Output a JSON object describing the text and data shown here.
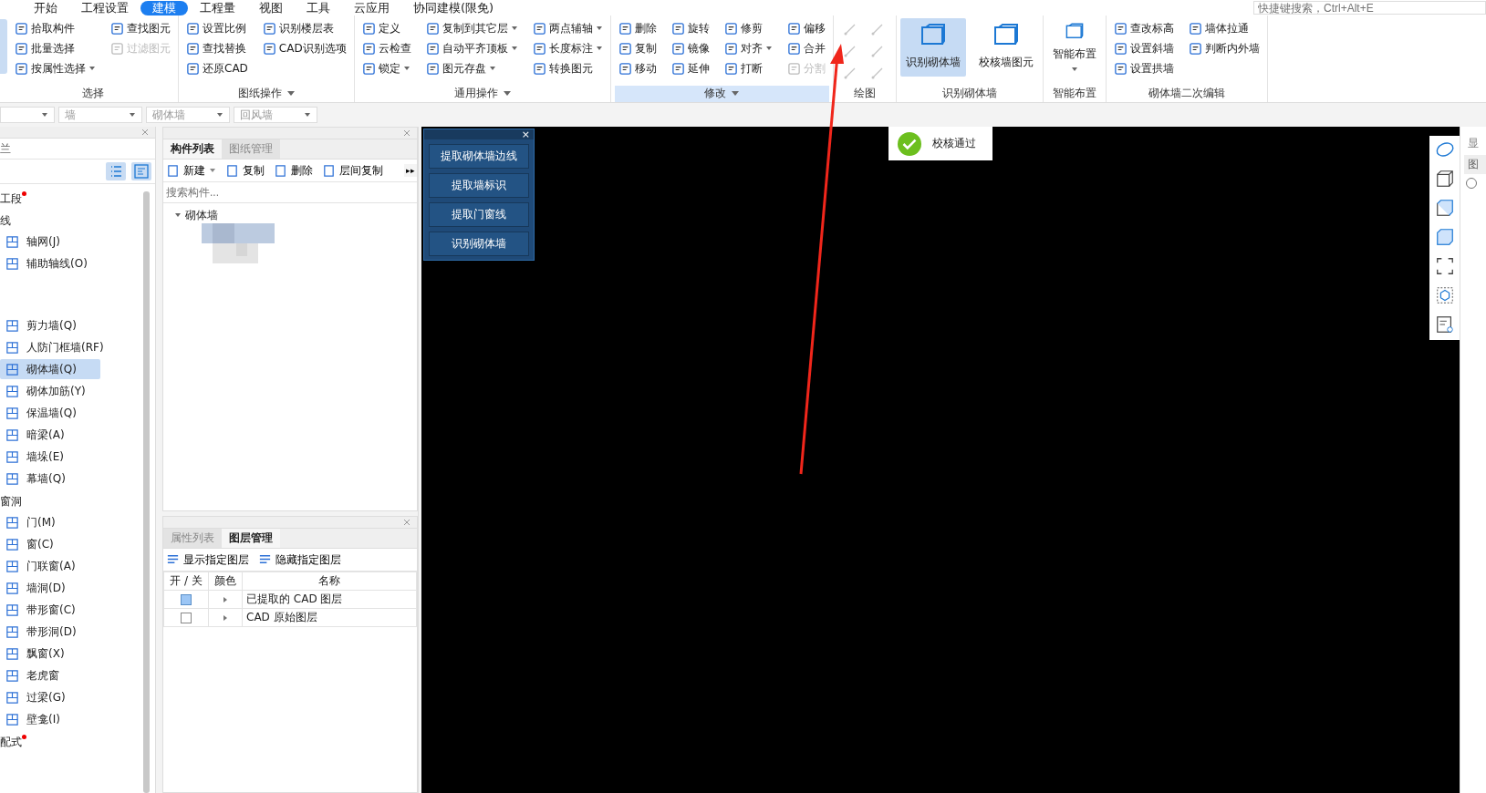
{
  "menu": {
    "tabs": [
      {
        "label": "开始",
        "selected": false
      },
      {
        "label": "工程设置",
        "selected": false
      },
      {
        "label": "建模",
        "selected": true
      },
      {
        "label": "工程量",
        "selected": false
      },
      {
        "label": "视图",
        "selected": false
      },
      {
        "label": "工具",
        "selected": false
      },
      {
        "label": "云应用",
        "selected": false
      },
      {
        "label": "协同建模(限免)",
        "selected": false
      }
    ],
    "search": {
      "placeholder": "快捷键搜索，Ctrl+Alt+E"
    }
  },
  "ribbon": {
    "groups": [
      {
        "kind": "small",
        "label": "选择",
        "dropdown": false,
        "highlighted": false,
        "columns": [
          [
            {
              "label": "拾取构件",
              "disabled": false,
              "dropdown": false
            },
            {
              "label": "批量选择",
              "disabled": false,
              "dropdown": false
            },
            {
              "label": "按属性选择",
              "disabled": false,
              "dropdown": true
            }
          ],
          [
            {
              "label": "查找图元",
              "disabled": false,
              "dropdown": false
            },
            {
              "label": "过滤图元",
              "disabled": true,
              "dropdown": false
            }
          ]
        ]
      },
      {
        "kind": "small",
        "label": "图纸操作",
        "dropdown": true,
        "highlighted": false,
        "columns": [
          [
            {
              "label": "设置比例",
              "disabled": false,
              "dropdown": false
            },
            {
              "label": "查找替换",
              "disabled": false,
              "dropdown": false
            },
            {
              "label": "还原CAD",
              "disabled": false,
              "dropdown": false
            }
          ],
          [
            {
              "label": "识别楼层表",
              "disabled": false,
              "dropdown": false
            },
            {
              "label": "CAD识别选项",
              "disabled": false,
              "dropdown": false
            }
          ]
        ]
      },
      {
        "kind": "small",
        "label": "通用操作",
        "dropdown": true,
        "highlighted": false,
        "columns": [
          [
            {
              "label": "定义",
              "disabled": false,
              "dropdown": false
            },
            {
              "label": "云检查",
              "disabled": false,
              "dropdown": false
            },
            {
              "label": "锁定",
              "disabled": false,
              "dropdown": true
            }
          ],
          [
            {
              "label": "复制到其它层",
              "disabled": false,
              "dropdown": true
            },
            {
              "label": "自动平齐顶板",
              "disabled": false,
              "dropdown": true
            },
            {
              "label": "图元存盘",
              "disabled": false,
              "dropdown": true
            }
          ],
          [
            {
              "label": "两点辅轴",
              "disabled": false,
              "dropdown": true
            },
            {
              "label": "长度标注",
              "disabled": false,
              "dropdown": true
            },
            {
              "label": "转换图元",
              "disabled": false,
              "dropdown": false
            }
          ]
        ]
      },
      {
        "kind": "small",
        "label": "修改",
        "dropdown": true,
        "highlighted": true,
        "columns": [
          [
            {
              "label": "删除",
              "disabled": false,
              "dropdown": false
            },
            {
              "label": "复制",
              "disabled": false,
              "dropdown": false
            },
            {
              "label": "移动",
              "disabled": false,
              "dropdown": false
            }
          ],
          [
            {
              "label": "旋转",
              "disabled": false,
              "dropdown": false
            },
            {
              "label": "镜像",
              "disabled": false,
              "dropdown": false
            },
            {
              "label": "延伸",
              "disabled": false,
              "dropdown": false
            }
          ],
          [
            {
              "label": "修剪",
              "disabled": false,
              "dropdown": false
            },
            {
              "label": "对齐",
              "disabled": false,
              "dropdown": true
            },
            {
              "label": "打断",
              "disabled": false,
              "dropdown": false
            }
          ],
          [
            {
              "label": "偏移",
              "disabled": false,
              "dropdown": false
            },
            {
              "label": "合并",
              "disabled": false,
              "dropdown": false
            },
            {
              "label": "分割",
              "disabled": true,
              "dropdown": false
            }
          ]
        ]
      },
      {
        "kind": "icons",
        "label": "绘图",
        "dropdown": false,
        "highlighted": false
      },
      {
        "kind": "big",
        "label": "识别砌体墙",
        "dropdown": false,
        "highlighted": false,
        "buttons": [
          {
            "label": "识别砌体墙",
            "selected": true,
            "dropdown": false
          },
          {
            "label": "校核墙图元",
            "selected": false,
            "dropdown": false
          }
        ]
      },
      {
        "kind": "big",
        "label": "智能布置",
        "dropdown": false,
        "highlighted": false,
        "buttons": [
          {
            "label": "智能布置",
            "selected": false,
            "dropdown": true
          }
        ]
      },
      {
        "kind": "small",
        "label": "砌体墙二次编辑",
        "dropdown": false,
        "highlighted": false,
        "columns": [
          [
            {
              "label": "查改标高",
              "disabled": false,
              "dropdown": false
            },
            {
              "label": "设置斜墙",
              "disabled": false,
              "dropdown": false
            },
            {
              "label": "设置拱墙",
              "disabled": false,
              "dropdown": false
            }
          ],
          [
            {
              "label": "墙体拉通",
              "disabled": false,
              "dropdown": false
            },
            {
              "label": "判断内外墙",
              "disabled": false,
              "dropdown": false
            }
          ]
        ]
      }
    ]
  },
  "selectors": [
    {
      "value": "墙"
    },
    {
      "value": "砌体墙"
    },
    {
      "value": "回风墙"
    }
  ],
  "nav_panel": {
    "title": "兰",
    "sections": [
      {
        "label": "工段",
        "dot": true
      },
      {
        "label": "线",
        "items": [
          {
            "label": "轴网(J)",
            "selected": false
          },
          {
            "label": "辅助轴线(O)",
            "selected": false
          }
        ]
      },
      {
        "items": [
          {
            "label": "剪力墙(Q)",
            "selected": false
          },
          {
            "label": "人防门框墙(RF)",
            "selected": false
          },
          {
            "label": "砌体墙(Q)",
            "selected": true
          },
          {
            "label": "砌体加筋(Y)",
            "selected": false
          },
          {
            "label": "保温墙(Q)",
            "selected": false
          },
          {
            "label": "暗梁(A)",
            "selected": false
          },
          {
            "label": "墙垛(E)",
            "selected": false
          },
          {
            "label": "幕墙(Q)",
            "selected": false
          }
        ]
      },
      {
        "label": "窗洞",
        "items": [
          {
            "label": "门(M)",
            "selected": false
          },
          {
            "label": "窗(C)",
            "selected": false
          },
          {
            "label": "门联窗(A)",
            "selected": false
          },
          {
            "label": "墙洞(D)",
            "selected": false
          },
          {
            "label": "带形窗(C)",
            "selected": false
          },
          {
            "label": "带形洞(D)",
            "selected": false
          },
          {
            "label": "飘窗(X)",
            "selected": false
          },
          {
            "label": "老虎窗",
            "selected": false
          },
          {
            "label": "过梁(G)",
            "selected": false
          },
          {
            "label": "壁龛(I)",
            "selected": false
          }
        ]
      },
      {
        "label": "配式",
        "dot": true
      }
    ]
  },
  "component_panel": {
    "tabs": [
      {
        "label": "构件列表",
        "selected": true
      },
      {
        "label": "图纸管理",
        "selected": false
      }
    ],
    "toolbar": [
      {
        "label": "新建",
        "dropdown": true
      },
      {
        "label": "复制",
        "dropdown": false
      },
      {
        "label": "删除",
        "dropdown": false
      },
      {
        "label": "层间复制",
        "dropdown": false
      }
    ],
    "more": "▸▸",
    "search": {
      "placeholder": "搜索构件..."
    },
    "tree": [
      {
        "label": "砌体墙",
        "expanded": true
      }
    ]
  },
  "layer_panel": {
    "tabs": [
      {
        "label": "属性列表",
        "selected": false
      },
      {
        "label": "图层管理",
        "selected": true
      }
    ],
    "actions": [
      "显示指定图层",
      "隐藏指定图层"
    ],
    "columns": [
      "开 / 关",
      "颜色",
      "名称"
    ],
    "rows": [
      {
        "checked": true,
        "expanded": false,
        "name": "已提取的 CAD 图层"
      },
      {
        "checked": false,
        "expanded": false,
        "name": "CAD 原始图层"
      }
    ]
  },
  "float_panel": {
    "close": "×",
    "buttons": [
      "提取砌体墙边线",
      "提取墙标识",
      "提取门窗线",
      "识别砌体墙"
    ]
  },
  "toast": {
    "text": "校核通过"
  },
  "side_panel": {
    "title": "显",
    "tab": "图",
    "radio": {
      "selected": false
    }
  }
}
